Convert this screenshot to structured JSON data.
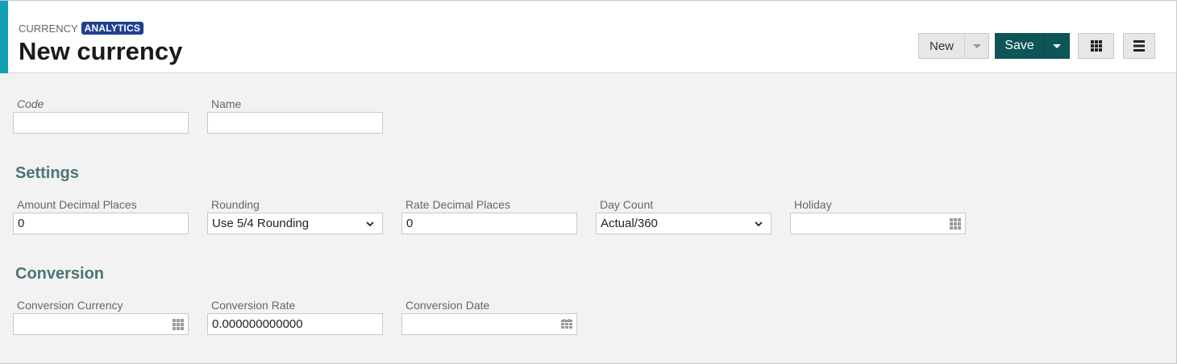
{
  "header": {
    "breadcrumb_model": "CURRENCY",
    "breadcrumb_badge": "ANALYTICS",
    "title": "New currency"
  },
  "toolbar": {
    "new_label": "New",
    "save_label": "Save",
    "grid_icon": "grid-view-icon",
    "menu_icon": "hamburger-menu-icon"
  },
  "colors": {
    "accent": "#14a0b3",
    "save_button": "#0d5556",
    "badge": "#1f3f93",
    "section_title": "#4d7475"
  },
  "main": {
    "code": {
      "label": "Code",
      "value": ""
    },
    "name": {
      "label": "Name",
      "value": ""
    }
  },
  "settings": {
    "title": "Settings",
    "amount_decimal_places": {
      "label": "Amount Decimal Places",
      "value": "0"
    },
    "rounding": {
      "label": "Rounding",
      "value": "Use 5/4 Rounding"
    },
    "rate_decimal_places": {
      "label": "Rate Decimal Places",
      "value": "0"
    },
    "day_count": {
      "label": "Day Count",
      "value": "Actual/360"
    },
    "holiday": {
      "label": "Holiday",
      "value": ""
    }
  },
  "conversion": {
    "title": "Conversion",
    "currency": {
      "label": "Conversion Currency",
      "value": ""
    },
    "rate": {
      "label": "Conversion Rate",
      "value": "0.000000000000"
    },
    "date": {
      "label": "Conversion Date",
      "value": ""
    }
  }
}
